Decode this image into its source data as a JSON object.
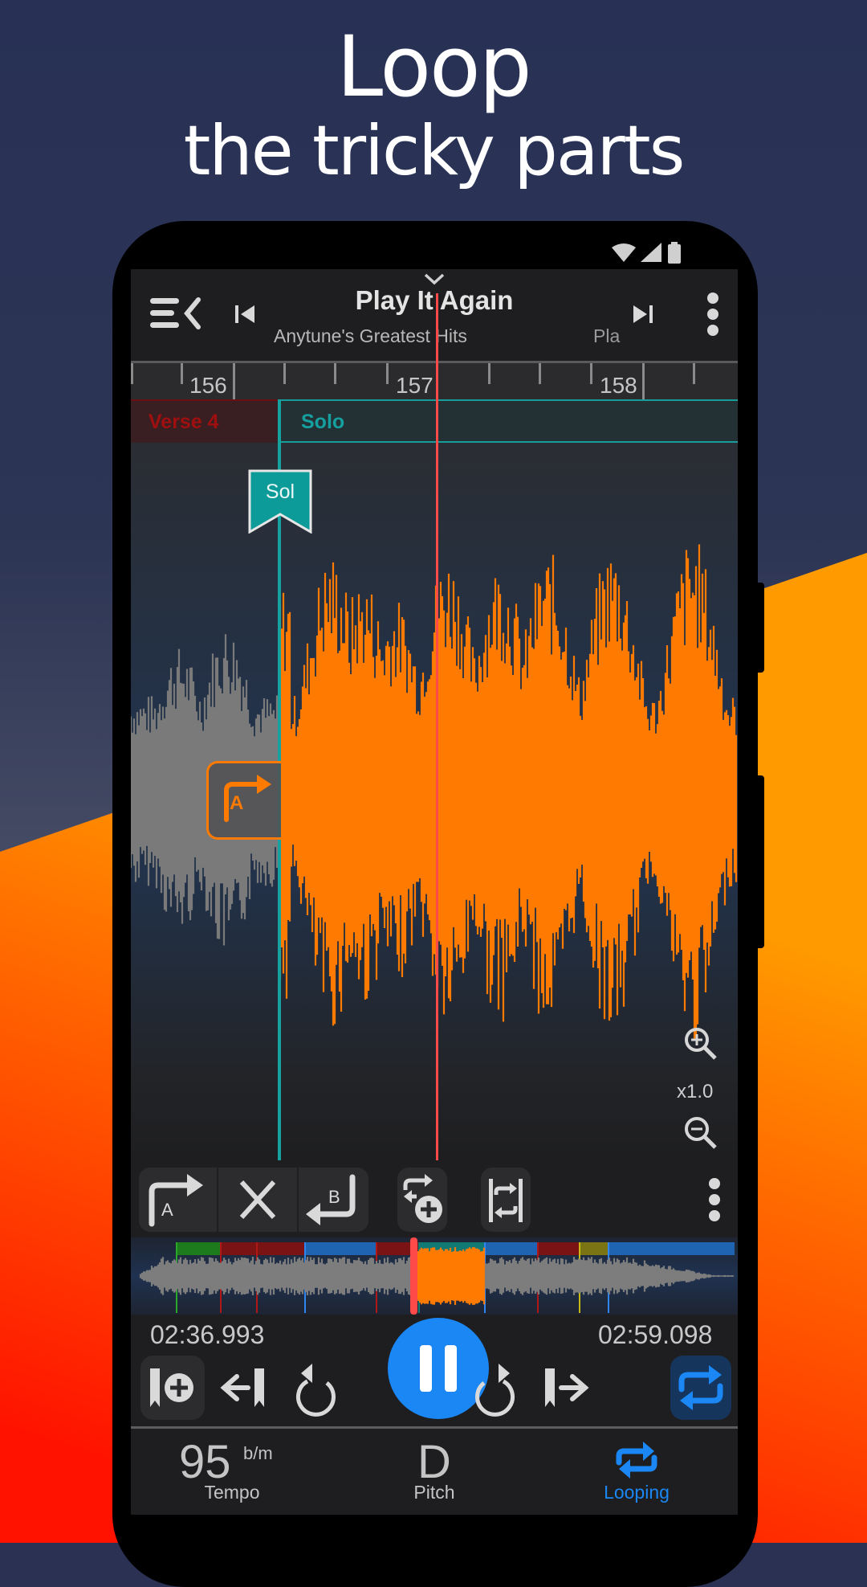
{
  "promo": {
    "headline_line1": "Loop",
    "headline_line2": "the tricky parts",
    "colors": {
      "navy": "#2a3152",
      "gray": "#6e7079",
      "orange": "#ff8a00",
      "red": "#ff1a00"
    }
  },
  "status_bar": {
    "icons": [
      "wifi-icon",
      "signal-icon",
      "battery-icon"
    ]
  },
  "header": {
    "collapse_icon": "chevron-down-icon",
    "title": "Play It Again",
    "subtitle": "Anytune's Greatest Hits",
    "subtitle_overflow": "Pla",
    "menu_icon": "menu-collapse-icon",
    "prev_icon": "skip-previous-icon",
    "next_icon": "skip-next-icon",
    "more_icon": "more-vertical-icon"
  },
  "timeline": {
    "bar_labels": [
      "156",
      "157",
      "158"
    ],
    "sections": [
      {
        "name": "Verse 4",
        "color": "#a00f0f"
      },
      {
        "name": "Solo",
        "color": "#15a09f"
      }
    ],
    "marker_flag": "Sol",
    "loop_start_marker": "A",
    "zoom_level": "x1.0",
    "accent_colors": {
      "waveform_selected": "#ff7a00",
      "waveform_unselected": "#7a7a7a",
      "playhead": "#ff4a4a",
      "loop_start_line": "#16a3a0"
    }
  },
  "loop_toolbar": {
    "buttons": [
      {
        "name": "set-loop-a",
        "label": "A"
      },
      {
        "name": "clear-loop",
        "label": ""
      },
      {
        "name": "set-loop-b",
        "label": "B"
      },
      {
        "name": "add-loop",
        "label": ""
      },
      {
        "name": "fit-loop",
        "label": ""
      }
    ]
  },
  "overview": {
    "segments": [
      {
        "color": "#1d7a1d"
      },
      {
        "color": "#7a1414"
      },
      {
        "color": "#7a1414"
      },
      {
        "color": "#1f63b3"
      },
      {
        "color": "#7a1414"
      },
      {
        "color": "#127a74"
      },
      {
        "color": "#1f63b3"
      },
      {
        "color": "#7a1414"
      },
      {
        "color": "#7a7414"
      },
      {
        "color": "#1f63b3"
      }
    ]
  },
  "transport": {
    "loop_start_time": "02:36.993",
    "loop_end_time": "02:59.098",
    "buttons": [
      "add-bookmark",
      "jump-to-previous-marker",
      "rewind",
      "pause",
      "fast-forward",
      "jump-to-next-marker",
      "loop-toggle"
    ],
    "loop_active": true,
    "accent": "#1a87f5"
  },
  "bottom_tabs": [
    {
      "value": "95",
      "unit": "b/m",
      "label": "Tempo",
      "active": false
    },
    {
      "value": "D",
      "label": "Pitch",
      "active": false
    },
    {
      "label": "Looping",
      "active": true
    }
  ]
}
